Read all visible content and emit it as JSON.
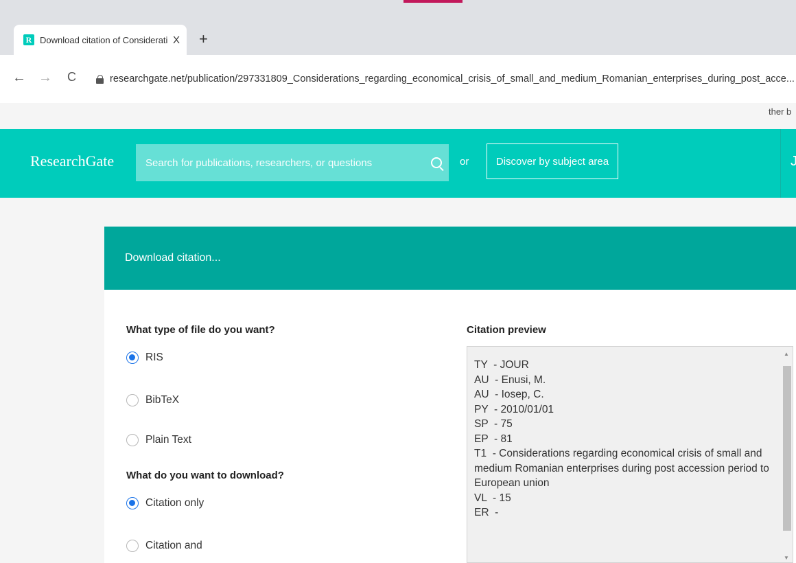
{
  "browser": {
    "tab_title": "Download citation of Considerati",
    "tab_close": "X",
    "new_tab": "+",
    "url": "researchgate.net/publication/297331809_Considerations_regarding_economical_crisis_of_small_and_medium_Romanian_enterprises_during_post_acce...",
    "back": "←",
    "forward": "→",
    "reload": "C",
    "bookmarks_fragment": "ther b",
    "favicon": "R"
  },
  "header": {
    "logo": "ResearchGate",
    "search_placeholder": "Search for publications, researchers, or questions",
    "or_label": "or",
    "discover_label": "Discover by subject area",
    "right_fragment": "J"
  },
  "dialog": {
    "title": "Download citation...",
    "file_type_question": "What type of file do you want?",
    "file_types": [
      {
        "label": "RIS",
        "checked": true
      },
      {
        "label": "BibTeX",
        "checked": false
      },
      {
        "label": "Plain Text",
        "checked": false
      }
    ],
    "download_question": "What do you want to download?",
    "download_options": [
      {
        "label": "Citation only",
        "checked": true
      },
      {
        "label": "Citation and",
        "checked": false
      }
    ],
    "preview_title": "Citation preview",
    "preview_lines": [
      "TY  - JOUR",
      "AU  - Enusi, M.",
      "AU  - Iosep, C.",
      "PY  - 2010/01/01",
      "SP  - 75",
      "EP  - 81",
      "T1  - Considerations regarding economical crisis of small and medium Romanian enterprises during post accession period to European union",
      "VL  - 15",
      "ER  -"
    ]
  },
  "colors": {
    "brand": "#00ccbb",
    "dialog_header": "#00a79b",
    "radio_active": "#1a73e8"
  }
}
